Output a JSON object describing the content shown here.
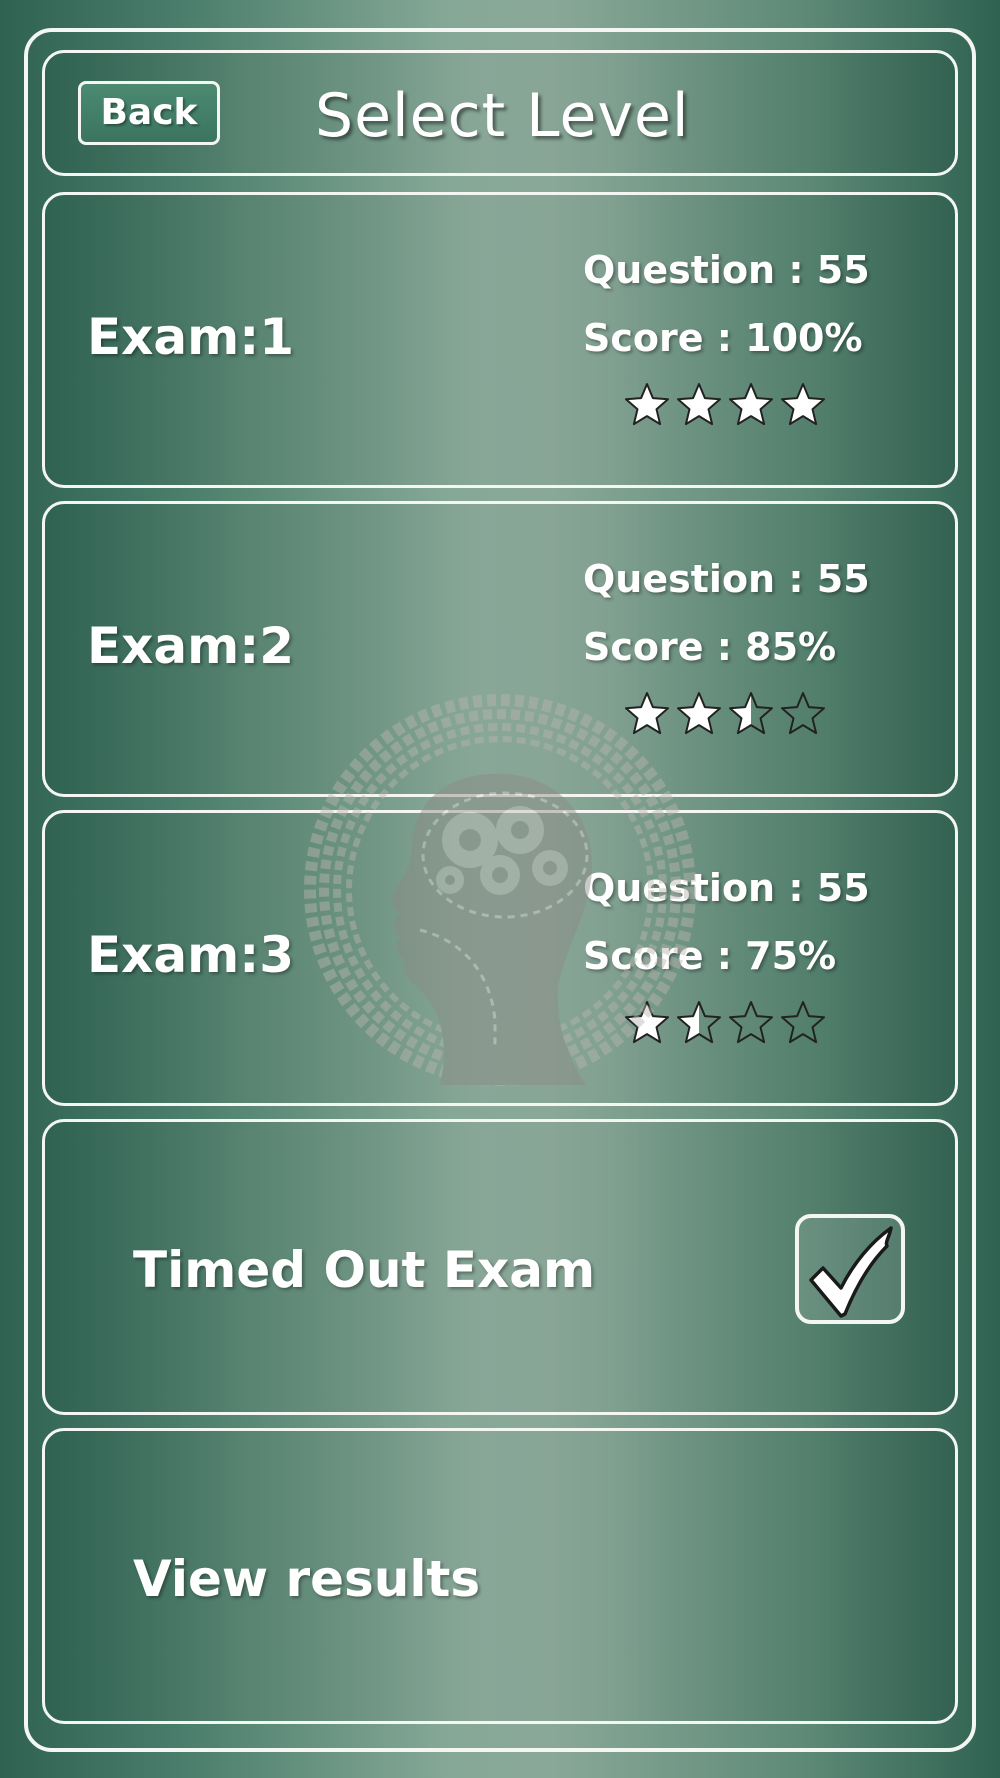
{
  "header": {
    "back_label": "Back",
    "title": "Select Level"
  },
  "exams": [
    {
      "label": "Exam:1",
      "question_text": "Question : 55",
      "score_text": "Score : 100%",
      "rating": 4,
      "rating_max": 4
    },
    {
      "label": "Exam:2",
      "question_text": "Question : 55",
      "score_text": "Score : 85%",
      "rating": 2.5,
      "rating_max": 4
    },
    {
      "label": "Exam:3",
      "question_text": "Question : 55",
      "score_text": "Score : 75%",
      "rating": 1.5,
      "rating_max": 4
    }
  ],
  "timed_out": {
    "label": "Timed Out Exam",
    "checked": true
  },
  "view_results": {
    "label": "View results"
  },
  "colors": {
    "background_dark": "#2f6251",
    "background_light": "#8aa898",
    "border": "#f3f6f3",
    "star_fill": "#ffffff",
    "star_outline": "#222222"
  },
  "icons": {
    "star": "star-icon",
    "check": "checkmark-icon",
    "watermark": "head-gears-icon"
  }
}
